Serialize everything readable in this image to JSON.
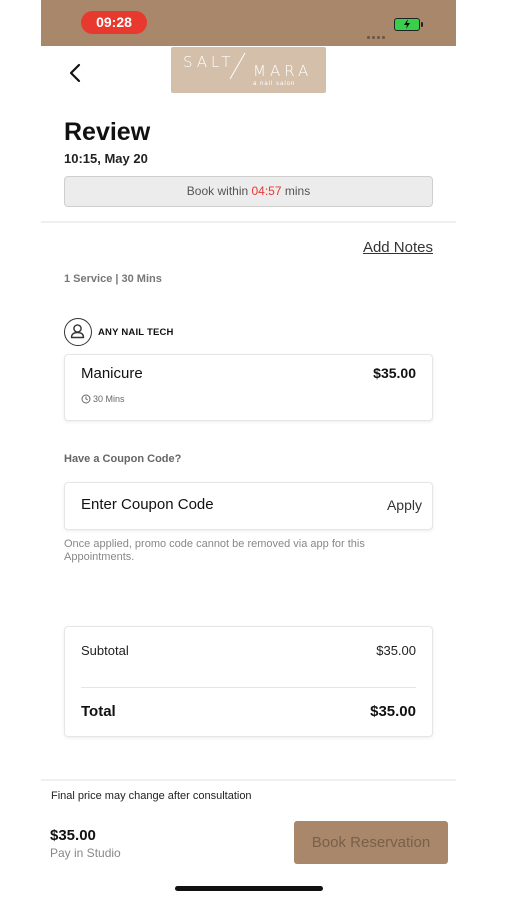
{
  "status_bar": {
    "time": "09:28",
    "accent_color": "#a8876a",
    "time_pill_color": "#e8392f"
  },
  "header": {
    "back_icon": "chevron-left-icon",
    "logo_text_1": "SALT",
    "logo_text_2": "MARA",
    "logo_text_3": "a nail salon"
  },
  "review": {
    "title": "Review",
    "datetime": "10:15, May 20",
    "timer_prefix": "Book within ",
    "timer_value": "04:57",
    "timer_suffix": " mins"
  },
  "notes": {
    "add_notes_label": "Add Notes"
  },
  "service_summary": "1 Service | 30 Mins",
  "technician": {
    "label": "ANY NAIL TECH",
    "icon": "user-icon"
  },
  "service": {
    "name": "Manicure",
    "price": "$35.00",
    "duration": "30 Mins",
    "duration_icon": "clock-icon"
  },
  "coupon": {
    "question": "Have a Coupon Code?",
    "placeholder": "Enter Coupon Code",
    "apply_label": "Apply",
    "note": "Once applied, promo code cannot be removed via app for this Appointments."
  },
  "totals": {
    "subtotal_label": "Subtotal",
    "subtotal_value": "$35.00",
    "total_label": "Total",
    "total_value": "$35.00"
  },
  "footer": {
    "price_note": "Final price may change after consultation",
    "price": "$35.00",
    "pay_label": "Pay in Studio",
    "book_label": "Book Reservation"
  }
}
